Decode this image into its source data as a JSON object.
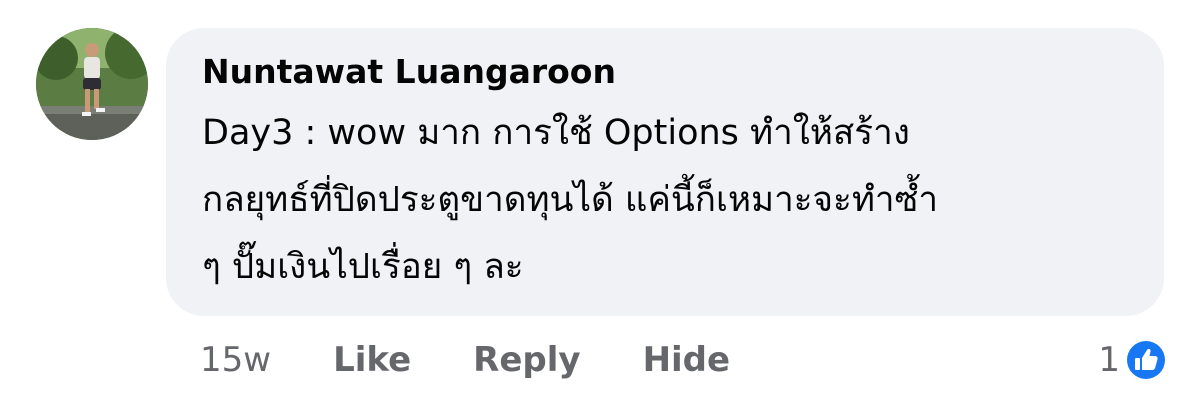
{
  "comment": {
    "author": "Nuntawat Luangaroon",
    "text_lines": [
      "Day3 : wow มาก การใช้ Options ทำให้สร้าง",
      "กลยุทธ์ที่ปิดประตูขาดทุนได้ แค่นี้ก็เหมาะจะทำซ้ำ",
      "ๆ ปั๊มเงินไปเรื่อย ๆ ละ"
    ],
    "timestamp": "15w",
    "actions": {
      "like": "Like",
      "reply": "Reply",
      "hide": "Hide"
    },
    "reaction_count": "1",
    "reaction_icon": "thumbs-up-icon",
    "reaction_color": "#1877f2"
  }
}
